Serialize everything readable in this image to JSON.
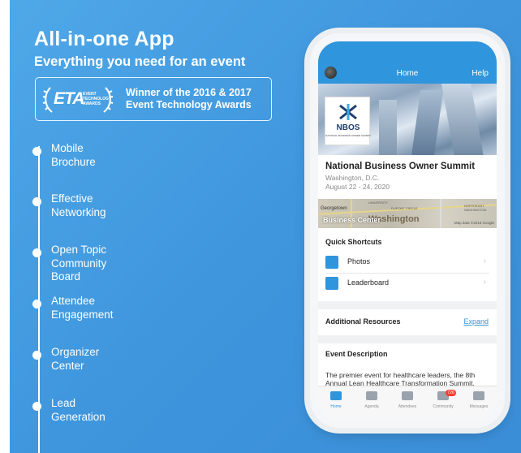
{
  "hero": {
    "title": "All-in-one App",
    "subtitle": "Everything you need for an event"
  },
  "award": {
    "logo_text": "ETA",
    "logo_subtext_1": "EVENT",
    "logo_subtext_2": "TECHNOLOGY",
    "logo_subtext_3": "AWARDS",
    "line1": "Winner of the 2016 & 2017",
    "line2": "Event Technology Awards"
  },
  "features": [
    {
      "line1": "Mobile",
      "line2": "Brochure",
      "line3": ""
    },
    {
      "line1": "Effective",
      "line2": "Networking",
      "line3": ""
    },
    {
      "line1": "Open Topic",
      "line2": "Community",
      "line3": "Board"
    },
    {
      "line1": "Attendee",
      "line2": "Engagement",
      "line3": ""
    },
    {
      "line1": "Organizer",
      "line2": "Center",
      "line3": ""
    },
    {
      "line1": "Lead",
      "line2": "Generation",
      "line3": ""
    }
  ],
  "app": {
    "header": {
      "title": "Home",
      "help": "Help"
    },
    "logo": {
      "text": "NBOS",
      "tagline": "NATIONAL BUSINESS OWNER SUMMIT"
    },
    "event": {
      "name": "National Business Owner Summit",
      "location": "Washington, D.C.",
      "dates": "August 22 - 24, 2020"
    },
    "map": {
      "georgetown": "Georgetown",
      "business_center": "Business Center",
      "washington": "Washington",
      "small_1": "DUPONT CIRCLE",
      "small_2": "NORTHEAST WASHINGTON",
      "small_3": "UNIVERSITY",
      "credit": "Map data ©2018 Google"
    },
    "shortcuts": {
      "title": "Quick Shortcuts",
      "items": [
        {
          "label": "Photos",
          "chevron": "›"
        },
        {
          "label": "Leaderboard",
          "chevron": "›"
        }
      ]
    },
    "resources": {
      "title": "Additional Resources",
      "expand": "Expand"
    },
    "description": {
      "title": "Event Description",
      "text": "The premier event for healthcare leaders, the 8th Annual Lean Healthcare Transformation Summit, hosted by Catal"
    },
    "tabs": [
      {
        "label": "Home",
        "active": true
      },
      {
        "label": "Agenda",
        "active": false
      },
      {
        "label": "Attendees",
        "active": false
      },
      {
        "label": "Community",
        "active": false,
        "badge": "726"
      },
      {
        "label": "Messages",
        "active": false
      }
    ]
  },
  "colors": {
    "panel_blue": "#4fa8e8",
    "app_blue": "#2f95dc",
    "badge_red": "#ff3b30"
  }
}
